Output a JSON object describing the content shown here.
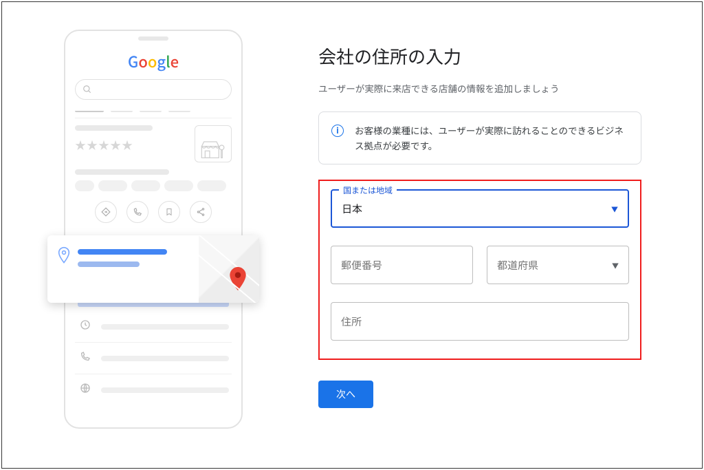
{
  "illustration": {
    "logo_letters": [
      "G",
      "o",
      "o",
      "g",
      "l",
      "e"
    ]
  },
  "heading": "会社の住所の入力",
  "subtitle": "ユーザーが実際に来店できる店舗の情報を追加しましょう",
  "info_banner": "お客様の業種には、ユーザーが実際に訪れることのできるビジネス拠点が必要です。",
  "fields": {
    "country_label": "国または地域",
    "country_value": "日本",
    "postal_placeholder": "郵便番号",
    "prefecture_placeholder": "都道府県",
    "address_placeholder": "住所"
  },
  "next_button": "次へ"
}
